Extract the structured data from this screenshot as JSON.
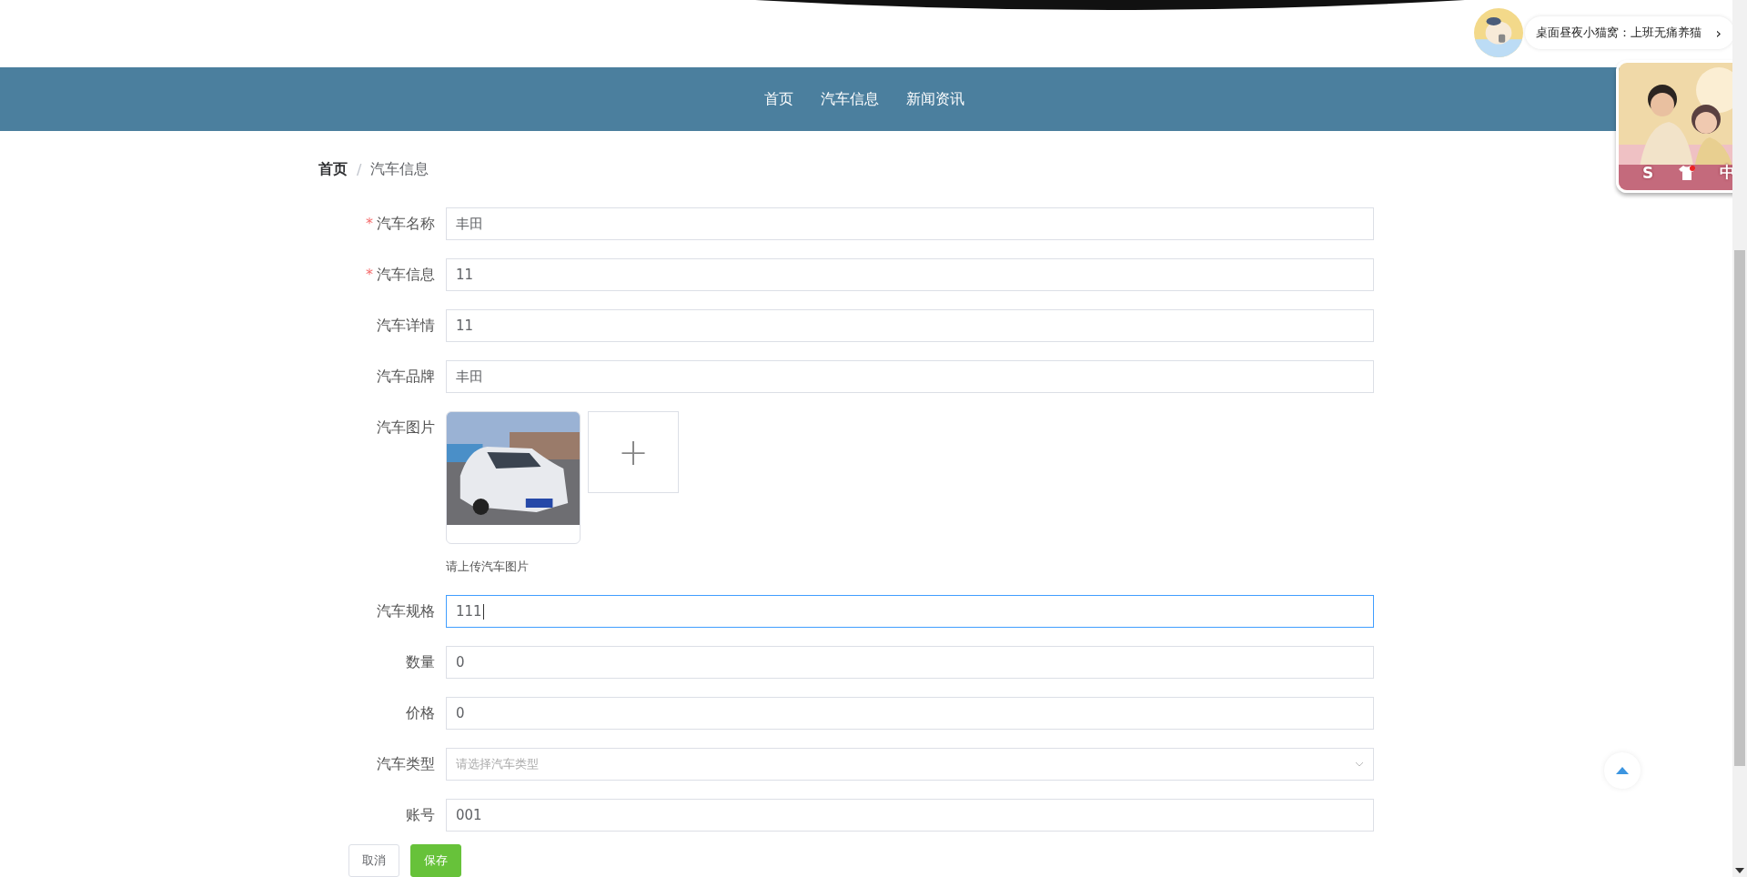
{
  "promo": {
    "text": "桌面昼夜小猫窝：上班无痛养猫",
    "chevron": "›",
    "badge_labels": [
      "S",
      "中"
    ]
  },
  "nav": {
    "items": [
      {
        "label": "首页",
        "selected": false
      },
      {
        "label": "汽车信息",
        "selected": false
      },
      {
        "label": "新闻资讯",
        "selected": false
      }
    ]
  },
  "breadcrumb": [
    {
      "label": "首页",
      "current": false
    },
    {
      "label": "汽车信息",
      "current": true
    }
  ],
  "breadcrumb_separator": "/",
  "form": {
    "fields": [
      {
        "kind": "text",
        "label": "汽车名称",
        "required": true,
        "value": "丰田",
        "focused": false
      },
      {
        "kind": "text",
        "label": "汽车信息",
        "required": true,
        "value": "11",
        "focused": false
      },
      {
        "kind": "text",
        "label": "汽车详情",
        "required": false,
        "value": "11",
        "focused": false
      },
      {
        "kind": "text",
        "label": "汽车品牌",
        "required": false,
        "value": "丰田",
        "focused": false
      },
      {
        "label": "汽车图片",
        "required": false,
        "hint": "请上传汽车图片",
        "add_label": "+"
      },
      {
        "kind": "text",
        "label": "汽车规格",
        "required": false,
        "value": "111",
        "focused": true
      },
      {
        "kind": "text",
        "label": "数量",
        "required": false,
        "value": "0",
        "focused": false
      },
      {
        "kind": "text",
        "label": "价格",
        "required": false,
        "value": "0",
        "focused": false
      },
      {
        "kind": "select",
        "label": "汽车类型",
        "required": false,
        "placeholder": "请选择汽车类型"
      },
      {
        "kind": "text",
        "label": "账号",
        "required": false,
        "value": "001",
        "focused": false
      }
    ],
    "required_mark": "*",
    "buttons": [
      {
        "label": "取消",
        "kind": "default"
      },
      {
        "label": "保存",
        "kind": "primary"
      }
    ]
  }
}
